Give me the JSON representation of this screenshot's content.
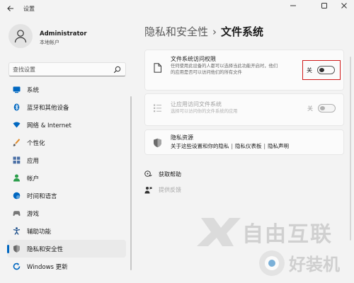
{
  "window": {
    "title": "设置",
    "back_icon": "back-arrow-icon",
    "controls": [
      "minimize-icon",
      "maximize-icon",
      "close-icon"
    ]
  },
  "profile": {
    "name": "Administrator",
    "account_type": "本地帐户"
  },
  "search": {
    "placeholder": "查找设置",
    "value": ""
  },
  "sidebar": {
    "items": [
      {
        "label": "系统",
        "icon": "system-icon",
        "active": false
      },
      {
        "label": "蓝牙和其他设备",
        "icon": "bluetooth-icon",
        "active": false
      },
      {
        "label": "网络 & Internet",
        "icon": "wifi-icon",
        "active": false
      },
      {
        "label": "个性化",
        "icon": "brush-icon",
        "active": false
      },
      {
        "label": "应用",
        "icon": "apps-icon",
        "active": false
      },
      {
        "label": "帐户",
        "icon": "account-icon",
        "active": false
      },
      {
        "label": "时间和语言",
        "icon": "globe-clock-icon",
        "active": false
      },
      {
        "label": "游戏",
        "icon": "gamepad-icon",
        "active": false
      },
      {
        "label": "辅助功能",
        "icon": "accessibility-icon",
        "active": false
      },
      {
        "label": "隐私和安全性",
        "icon": "shield-icon",
        "active": true
      },
      {
        "label": "Windows 更新",
        "icon": "update-icon",
        "active": false
      }
    ]
  },
  "breadcrumb": {
    "parent": "隐私和安全性",
    "separator": "›",
    "current": "文件系统"
  },
  "settings": {
    "file_system_access": {
      "title": "文件系统访问权限",
      "description": "任何使用此设备的人都可以选择当此功能开启时，他们的应用是否可以访问他们的所有文件",
      "toggle_label": "关",
      "toggle_on": false,
      "icon": "document-icon"
    },
    "app_file_access": {
      "title": "让应用访问文件系统",
      "description": "选择可以访问你的文件系统的应用",
      "toggle_label": "关",
      "toggle_on": false,
      "disabled": true,
      "icon": "list-icon"
    },
    "privacy_resources": {
      "title": "隐私资源",
      "links": [
        "关于这些设置和你的隐私",
        "隐私仪表板",
        "隐私声明"
      ],
      "icon": "shield-icon"
    }
  },
  "help": {
    "get_help": "获取帮助",
    "feedback": "提供反馈"
  },
  "colors": {
    "accent": "#0067c0",
    "highlight_box": "#d01a1a",
    "background": "#f3f3f3",
    "card": "#fbfbfb"
  },
  "watermarks": {
    "brand1": "自由互联",
    "brand2": "好装机"
  }
}
